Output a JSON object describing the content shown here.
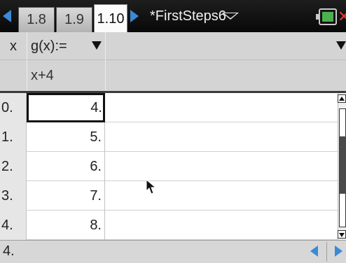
{
  "tabs": [
    {
      "label": "1.8",
      "active": false
    },
    {
      "label": "1.9",
      "active": false
    },
    {
      "label": "1.10",
      "active": true
    }
  ],
  "document": {
    "title": "*FirstSteps6"
  },
  "icons": {
    "prev_page": "left-arrow-icon",
    "next_page": "right-arrow-icon",
    "doc_menu": "chevron-down-icon",
    "battery": "battery-icon",
    "close": "close-icon",
    "cursor": "mouse-pointer-icon"
  },
  "table": {
    "var_label": "x",
    "column_header": "g(x):=",
    "formula": "x+4",
    "rows": [
      {
        "index": "0.",
        "value": "4."
      },
      {
        "index": "1.",
        "value": "5."
      },
      {
        "index": "2.",
        "value": "6."
      },
      {
        "index": "3.",
        "value": "7."
      },
      {
        "index": "4.",
        "value": "8."
      }
    ],
    "selected_row": 0
  },
  "status": {
    "text": "4."
  },
  "colors": {
    "accent": "#3a8ad6",
    "close": "#e53935",
    "battery": "#4caf50"
  }
}
